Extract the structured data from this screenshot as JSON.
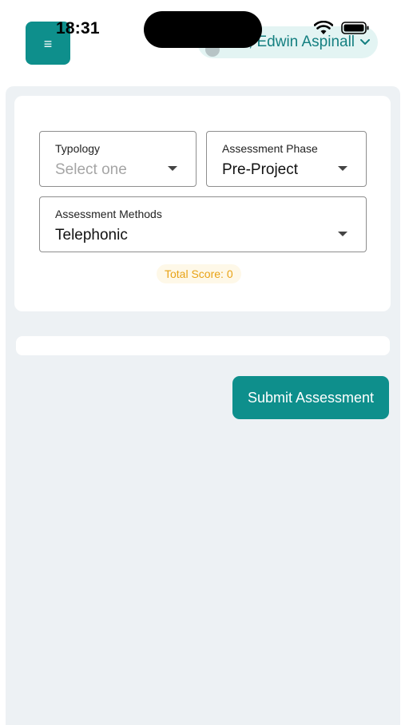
{
  "status_bar": {
    "time": "18:31"
  },
  "header": {
    "menu_icon": "≡",
    "user_greeting": "Hi, Edwin Aspinall",
    "avatar_icon": "user-avatar",
    "chevron_icon": "chevron-down-icon"
  },
  "form": {
    "typology": {
      "label": "Typology",
      "placeholder": "Select one"
    },
    "assessment_phase": {
      "label": "Assessment Phase",
      "value": "Pre-Project"
    },
    "assessment_methods": {
      "label": "Assessment Methods",
      "value": "Telephonic"
    },
    "total_score": "Total Score: 0"
  },
  "actions": {
    "submit_label": "Submit Assessment"
  },
  "colors": {
    "primary": "#0e8f8c",
    "user_pill_bg": "#e3f4f3",
    "score_text": "#e8a317",
    "panel_bg": "#edf1f4"
  }
}
